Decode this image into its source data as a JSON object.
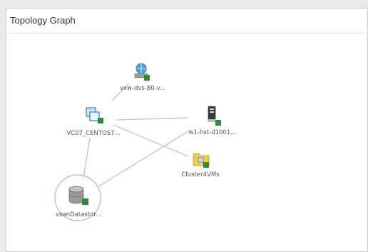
{
  "panel": {
    "title": "Topology Graph"
  },
  "graph": {
    "nodes": [
      {
        "id": "vxw",
        "label": "vxw-dvs-80-v...",
        "icon": "network-portgroup-icon",
        "status": "normal"
      },
      {
        "id": "vc07",
        "label": "VC07_CENTOS7...",
        "icon": "virtual-machine-icon",
        "status": "normal"
      },
      {
        "id": "w1",
        "label": "w1-hst-d1001...",
        "icon": "host-server-icon",
        "status": "normal"
      },
      {
        "id": "cluster",
        "label": "Cluster4VMs",
        "icon": "cluster-folder-icon",
        "status": "normal"
      },
      {
        "id": "vsan",
        "label": "vsanDatastor...",
        "icon": "datastore-icon",
        "status": "normal",
        "selected": true
      }
    ],
    "edges": [
      {
        "from": "vxw",
        "to": "vc07"
      },
      {
        "from": "vc07",
        "to": "w1"
      },
      {
        "from": "vc07",
        "to": "cluster"
      },
      {
        "from": "vc07",
        "to": "vsan"
      },
      {
        "from": "w1",
        "to": "vsan"
      }
    ],
    "colors": {
      "edge": "#a9c4da",
      "status_ok": "#2e8b3a",
      "selection_ring": "#f0a39c",
      "label": "#555555"
    }
  }
}
